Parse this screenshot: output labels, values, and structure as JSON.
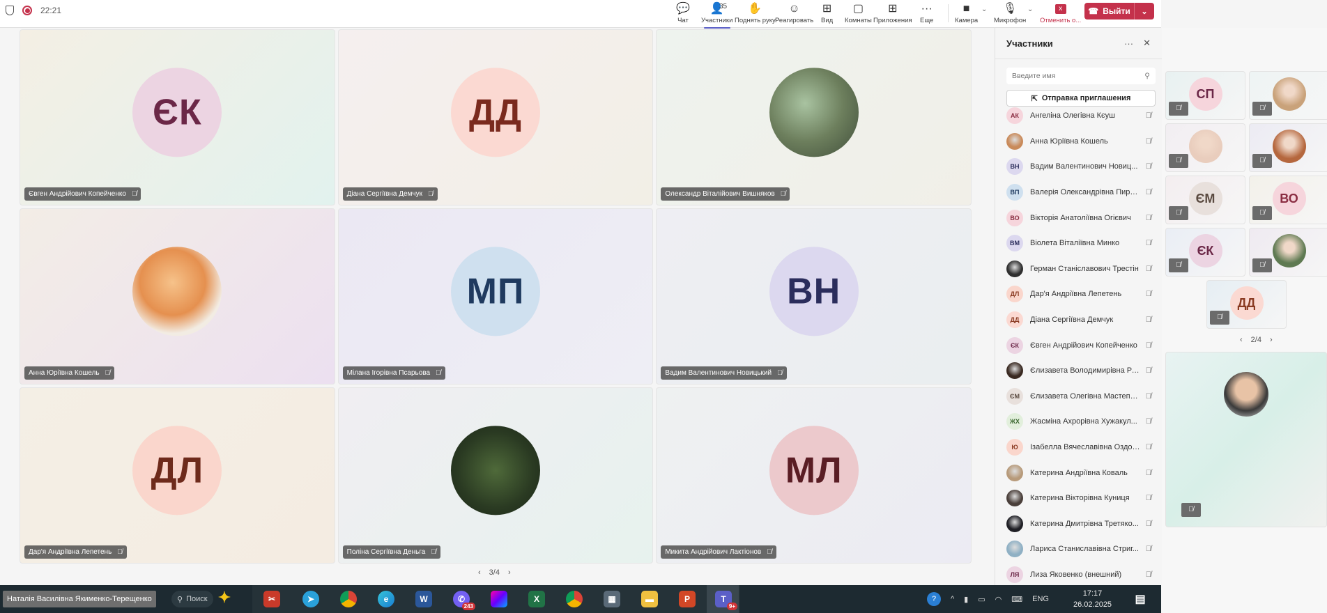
{
  "topbar": {
    "time": "22:21"
  },
  "toolbar": {
    "chat": "Чат",
    "participants": "Участники",
    "participants_count": "35",
    "raise_hand": "Поднять руку",
    "react": "Реагировать",
    "view": "Вид",
    "rooms": "Комнаты",
    "apps": "Приложения",
    "more": "Еще",
    "camera": "Камера",
    "mic": "Микрофон",
    "cancel": "Отменить о...",
    "leave": "Выйти"
  },
  "grid": {
    "page": "3/4",
    "tiles": [
      {
        "name": "Євген Андрійович Копейченко",
        "initials": "ЄК",
        "bg": "#ecd4e2",
        "fg": "#6b2747",
        "tile": "linear-gradient(135deg,#f4efe4,#e2f2ee)"
      },
      {
        "name": "Діана Сергіївна Демчук",
        "initials": "ДД",
        "bg": "#fbd9d2",
        "fg": "#7a2a1e",
        "tile": "linear-gradient(135deg,#f5efef,#f2efe6)"
      },
      {
        "name": "Олександр Віталійович Вишняков",
        "initials": "",
        "photo": "radial-gradient(circle at 40% 40%,#a9c3a1,#6d7f5d 50%,#3f4d3a)",
        "tile": "linear-gradient(135deg,#eef3ee,#f1efe8)"
      },
      {
        "name": "Анна Юріївна Кошель",
        "initials": "",
        "photo": "radial-gradient(circle at 45% 40%,#f6c28a,#e5904f 45%,#f2ece3 70%)",
        "tile": "linear-gradient(135deg,#f3ede6,#ece0f0)"
      },
      {
        "name": "Мілана Ігорівна Псарьова",
        "initials": "МП",
        "bg": "#cfe0ef",
        "fg": "#1f3a5f",
        "tile": "linear-gradient(135deg,#ebe8f3,#eeeef5)"
      },
      {
        "name": "Вадим Валентинович Новицький",
        "initials": "ВН",
        "bg": "#dcd8ef",
        "fg": "#2b2d5c",
        "tile": "linear-gradient(135deg,#eeeef3,#eaeef0)"
      },
      {
        "name": "Дар'я Андріївна Лепетень",
        "initials": "ДЛ",
        "bg": "#fad6cc",
        "fg": "#6e2a1b",
        "tile": "linear-gradient(135deg,#f4efe5,#f4ece2)"
      },
      {
        "name": "Поліна Сергіївна Деньга",
        "initials": "",
        "photo": "radial-gradient(circle at 50% 50%,#4f6a3a,#2a3a22 60%,#1b2617)",
        "tile": "linear-gradient(135deg,#f0eef2,#e7f2ee)"
      },
      {
        "name": "Микита Андрійович Лактіонов",
        "initials": "МЛ",
        "bg": "#ecc9cc",
        "fg": "#5a1d24",
        "tile": "linear-gradient(135deg,#eef1f1,#ecebf3)"
      }
    ]
  },
  "panel": {
    "title": "Участники",
    "search_placeholder": "Введите имя",
    "invite": "Отправка приглашения",
    "items": [
      {
        "name": "Ангеліна Олегівна Кєуш",
        "initials": "АК",
        "bg": "#f6d5dc",
        "fg": "#8a2d42"
      },
      {
        "name": "Анна Юріївна Кошель",
        "photo": "#c98a5a"
      },
      {
        "name": "Вадим Валентинович Новиц...",
        "initials": "ВН",
        "bg": "#dcd8ef",
        "fg": "#2b2d5c"
      },
      {
        "name": "Валерія Олександрівна Пиро...",
        "initials": "ВП",
        "bg": "#cfe0ef",
        "fg": "#1f3a5f"
      },
      {
        "name": "Вікторія Анатоліївна Огієвич",
        "initials": "ВО",
        "bg": "#f6d5dc",
        "fg": "#8a2d42"
      },
      {
        "name": "Віолета Віталіївна Минко",
        "initials": "ВМ",
        "bg": "#dcd8ef",
        "fg": "#2b2d5c"
      },
      {
        "name": "Герман Станіславович Трестін",
        "photo": "#2f2f2f"
      },
      {
        "name": "Дар'я Андріївна Лепетень",
        "initials": "ДЛ",
        "bg": "#fad6cc",
        "fg": "#8a3a22"
      },
      {
        "name": "Діана Сергіївна Демчук",
        "initials": "ДД",
        "bg": "#fbd9d2",
        "fg": "#8a3a22"
      },
      {
        "name": "Євген Андрійович Копейченко",
        "initials": "ЄК",
        "bg": "#ecd4e2",
        "fg": "#6b2747"
      },
      {
        "name": "Єлизавета Володимирівна Ро...",
        "photo": "#3a2a22"
      },
      {
        "name": "Єлизавета Олегівна Мастепа...",
        "initials": "ЄМ",
        "bg": "#e8e0dc",
        "fg": "#5a4a40"
      },
      {
        "name": "Жасміна Ахрорівна Хужакул...",
        "initials": "ЖХ",
        "bg": "#e2efdc",
        "fg": "#3e6a32"
      },
      {
        "name": "Ізабелла Вячеславівна Оздоба",
        "initials": "Ю",
        "bg": "#fad6cc",
        "fg": "#8a3a22"
      },
      {
        "name": "Катерина Андріївна Коваль",
        "photo": "#b79a7a"
      },
      {
        "name": "Катерина Вікторівна Куниця",
        "photo": "#4a3f3a"
      },
      {
        "name": "Катерина Дмитрівна Третяко...",
        "photo": "#1f1f25"
      },
      {
        "name": "Лариса Станиславівна Стриг...",
        "photo": "#8fb0c4"
      },
      {
        "name": "Лиза Яковенко (внешний)",
        "initials": "ЛЯ",
        "bg": "#ecd4e2",
        "fg": "#6b2747"
      }
    ]
  },
  "gallery": {
    "page": "2/4",
    "tiles": [
      {
        "initials": "СП",
        "bg": "#f6d5dc",
        "fg": "#6b2747"
      },
      {
        "initials": "",
        "photo": "#c9a27a"
      },
      {
        "initials": "",
        "photo": "#e9cdbd"
      },
      {
        "initials": "",
        "photo": "#b5673e"
      },
      {
        "initials": "ЄМ",
        "bg": "#e8e0dc",
        "fg": "#5a4a40"
      },
      {
        "initials": "ВО",
        "bg": "#f6d5dc",
        "fg": "#8a2d42"
      },
      {
        "initials": "ЄК",
        "bg": "#ecd4e2",
        "fg": "#6b2747"
      },
      {
        "initials": "",
        "photo": "#5f7a52"
      },
      {
        "initials": "ДД",
        "bg": "#fbd9d2",
        "fg": "#8a3a22"
      }
    ]
  },
  "taskbar": {
    "tooltip": "Наталія Василівна Якименко-Терещенко",
    "search": "Поиск",
    "lang": "ENG",
    "time": "17:17",
    "date": "26.02.2025",
    "viber_badge": "243",
    "teams_badge": "9+"
  }
}
